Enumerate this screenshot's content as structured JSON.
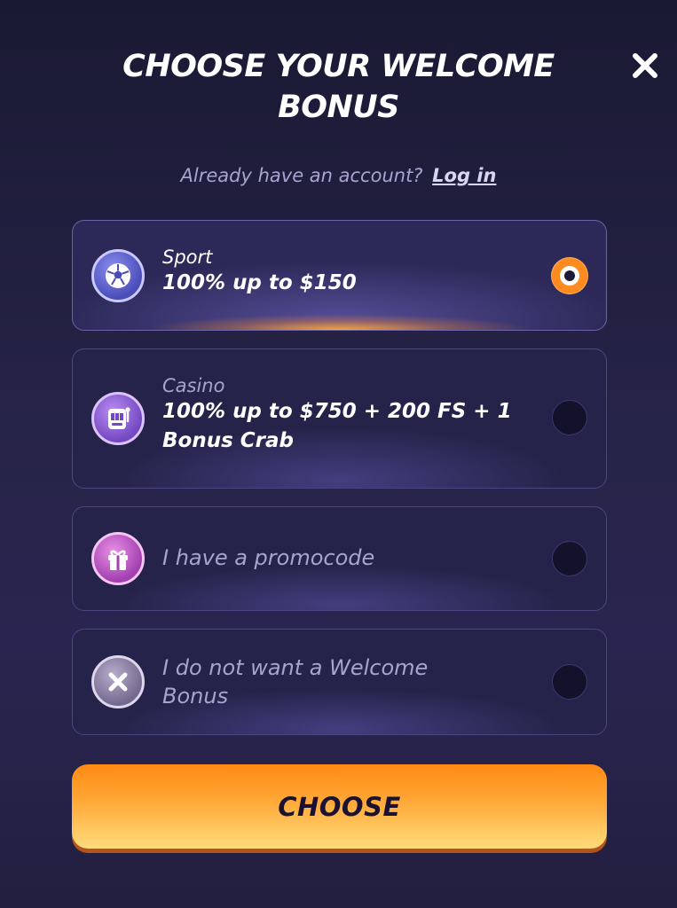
{
  "modal": {
    "title": "CHOOSE YOUR WELCOME BONUS",
    "account_prompt": "Already have an account?",
    "login_link": "Log in",
    "close_icon": "close-icon"
  },
  "options": [
    {
      "label": "Sport",
      "value": "100% up to $150",
      "icon": "soccer-ball-icon",
      "selected": true
    },
    {
      "label": "Casino",
      "value": "100% up to $750 + 200 FS + 1 Bonus Crab",
      "icon": "slot-machine-icon",
      "selected": false
    },
    {
      "label": "I have a promocode",
      "icon": "gift-icon",
      "selected": false
    },
    {
      "label": "I do not want a Welcome Bonus",
      "icon": "cross-icon",
      "selected": false
    }
  ],
  "choose_button": {
    "label": "CHOOSE"
  },
  "colors": {
    "background": "#221f40",
    "accent": "#ff8a1f",
    "muted_text": "#a8a3cf",
    "card_border": "#4c4683"
  }
}
